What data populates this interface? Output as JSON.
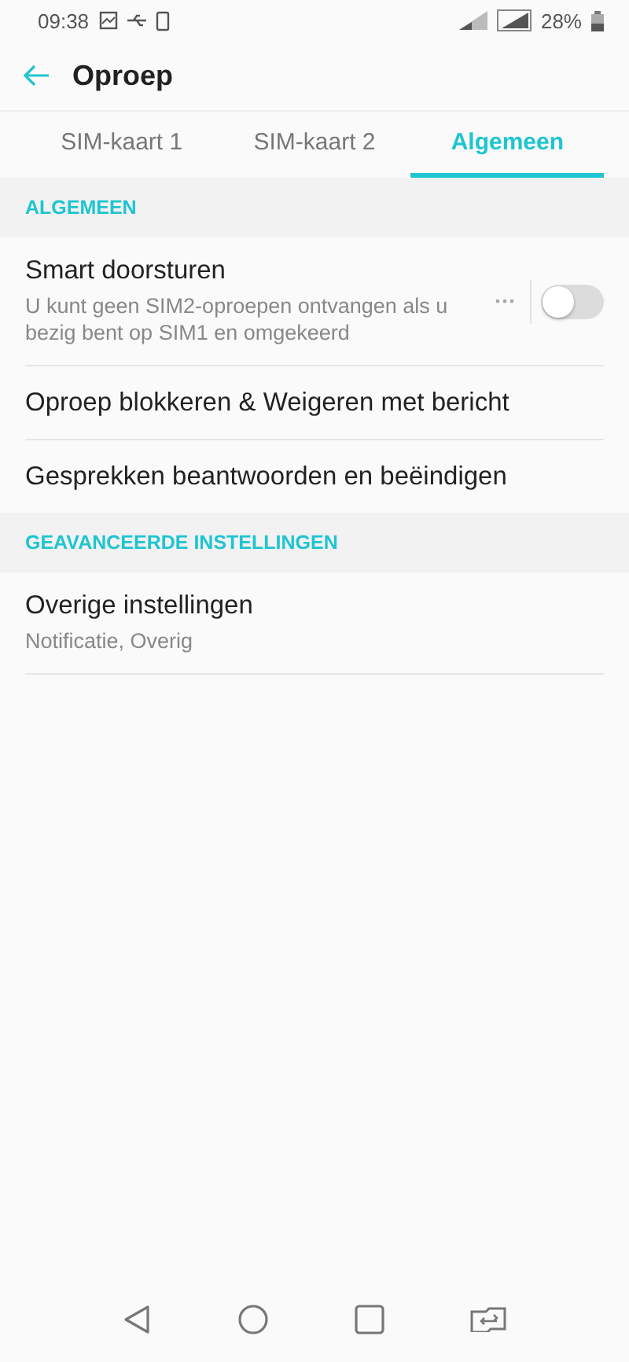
{
  "status_bar": {
    "time": "09:38",
    "battery": "28%"
  },
  "header": {
    "title": "Oproep"
  },
  "tabs": [
    {
      "label": "SIM-kaart 1",
      "selected": false
    },
    {
      "label": "SIM-kaart 2",
      "selected": false
    },
    {
      "label": "Algemeen",
      "selected": true
    }
  ],
  "sections": [
    {
      "title": "ALGEMEEN",
      "items": [
        {
          "kind": "toggle",
          "title": "Smart doorsturen",
          "subtitle": "U kunt geen SIM2-oproepen ontvangen als u bezig bent op SIM1 en omgekeerd",
          "on": false
        },
        {
          "kind": "plain",
          "title": "Oproep blokkeren & Weigeren met bericht"
        },
        {
          "kind": "plain",
          "title": "Gesprekken beantwoorden en beëindigen"
        }
      ]
    },
    {
      "title": "GEAVANCEERDE INSTELLINGEN",
      "items": [
        {
          "kind": "plain",
          "title": "Overige instellingen",
          "subtitle": "Notificatie, Overig"
        }
      ]
    }
  ]
}
